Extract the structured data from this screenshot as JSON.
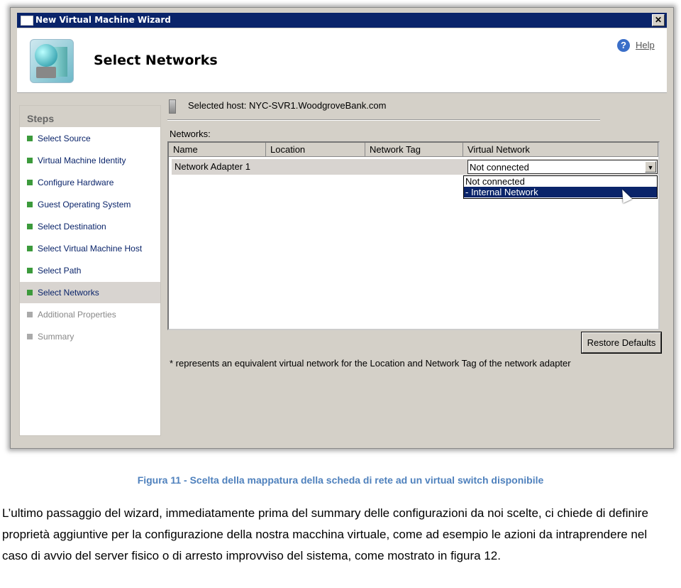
{
  "window": {
    "title": "New Virtual Machine Wizard",
    "close": "✕"
  },
  "header": {
    "title": "Select Networks",
    "help": "Help"
  },
  "steps": {
    "heading": "Steps",
    "items": [
      {
        "label": "Select Source",
        "state": "done"
      },
      {
        "label": "Virtual Machine Identity",
        "state": "done"
      },
      {
        "label": "Configure Hardware",
        "state": "done"
      },
      {
        "label": "Guest Operating System",
        "state": "done"
      },
      {
        "label": "Select Destination",
        "state": "done"
      },
      {
        "label": "Select Virtual Machine Host",
        "state": "done"
      },
      {
        "label": "Select Path",
        "state": "done"
      },
      {
        "label": "Select Networks",
        "state": "current"
      },
      {
        "label": "Additional Properties",
        "state": "pending"
      },
      {
        "label": "Summary",
        "state": "pending"
      }
    ]
  },
  "main": {
    "host": "Selected host: NYC-SVR1.WoodgroveBank.com",
    "networks_label": "Networks:",
    "columns": [
      "Name",
      "Location",
      "Network Tag",
      "Virtual Network"
    ],
    "row": {
      "name": "Network Adapter 1",
      "location": "",
      "tag": "",
      "virtual_network": "Not connected"
    },
    "dropdown_options": [
      "Not connected",
      "- Internal Network"
    ],
    "restore": "Restore Defaults",
    "footnote": "* represents an equivalent virtual network for the Location and Network Tag of the network adapter"
  },
  "caption": "Figura 11 - Scelta della mappatura della scheda di rete ad un virtual switch disponibile",
  "paragraph": "L’ultimo passaggio del wizard, immediatamente prima del summary delle configurazioni da noi scelte, ci chiede di definire proprietà aggiuntive per la configurazione della nostra macchina virtuale, come ad esempio le azioni da intraprendere nel caso di avvio del server fisico o di arresto improvviso del sistema, come mostrato in figura 12."
}
